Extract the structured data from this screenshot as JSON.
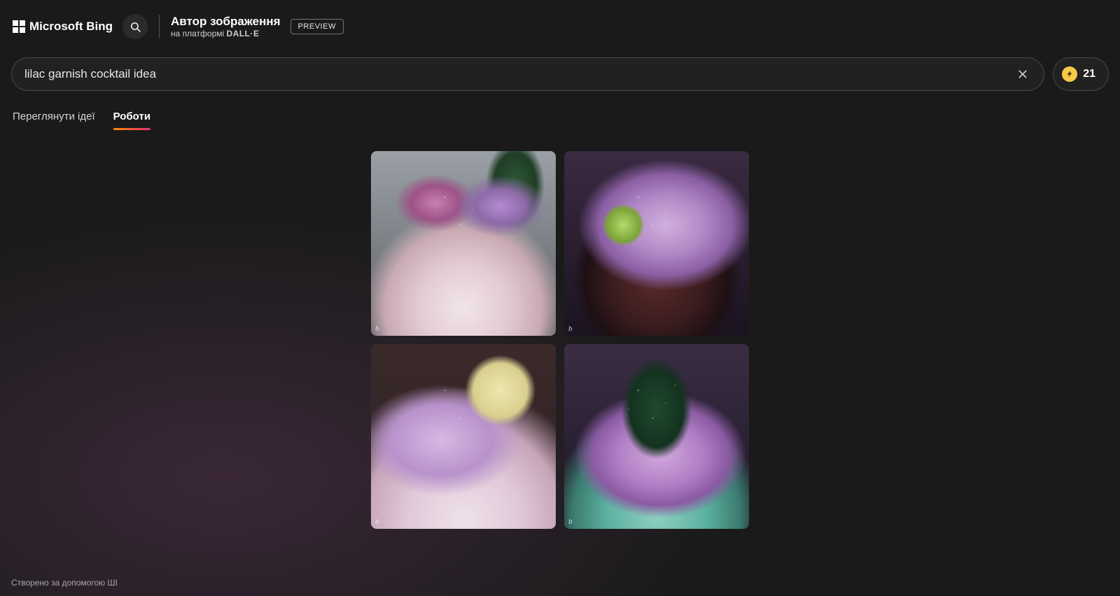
{
  "header": {
    "logo_text": "Microsoft Bing",
    "title": "Автор зображення",
    "subtitle_prefix": "на платформі ",
    "subtitle_brand": "DALL·E",
    "preview_badge": "PREVIEW"
  },
  "prompt": {
    "value": "lilac garnish cocktail idea"
  },
  "credits": {
    "count": "21"
  },
  "tabs": {
    "ideas": "Переглянути ідеї",
    "works": "Роботи"
  },
  "results": {
    "watermark": "b",
    "tiles": [
      "t1",
      "t2",
      "t3",
      "t4"
    ]
  },
  "footer": {
    "note": "Створено за допомогою ШІ"
  }
}
